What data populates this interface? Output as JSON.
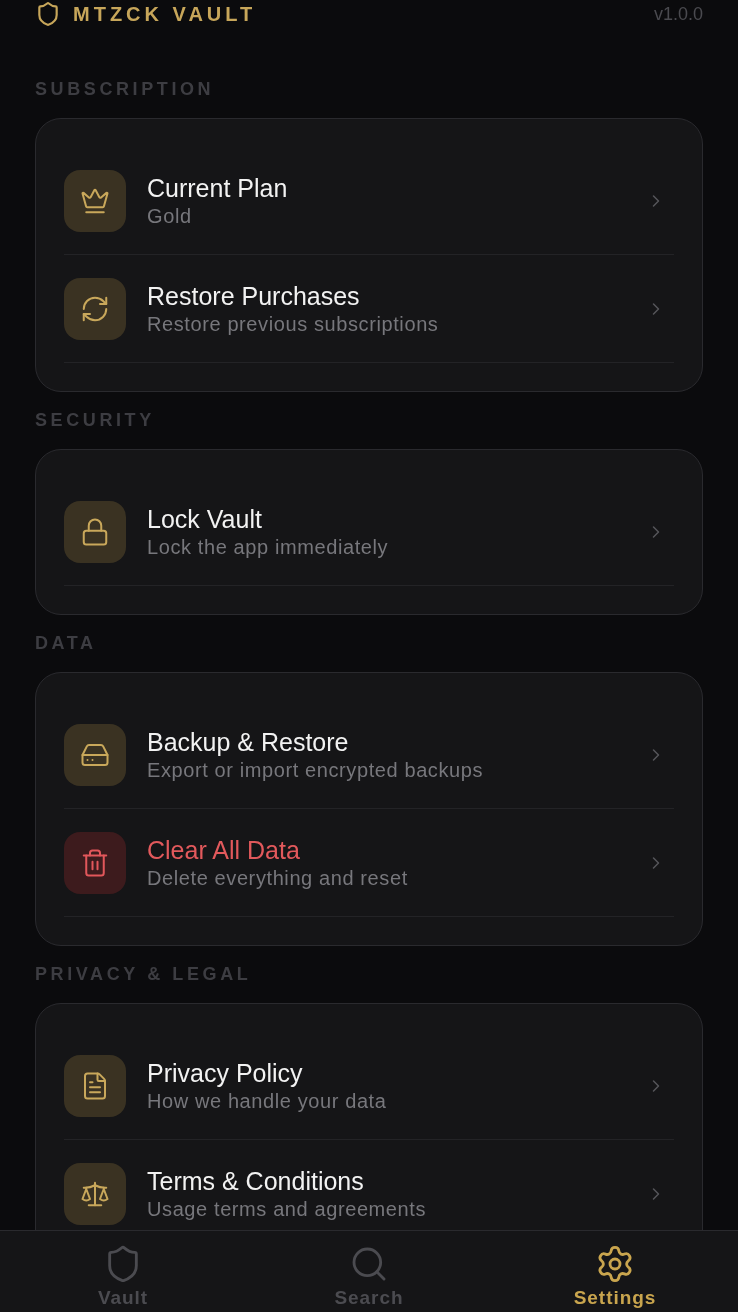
{
  "header": {
    "title": "MTZCK VAULT",
    "version": "v1.0.0"
  },
  "sections": [
    {
      "title": "SUBSCRIPTION",
      "items": [
        {
          "kind": "default",
          "title": "Current Plan",
          "subtitle": "Gold"
        },
        {
          "kind": "default",
          "title": "Restore Purchases",
          "subtitle": "Restore previous subscriptions"
        }
      ]
    },
    {
      "title": "SECURITY",
      "items": [
        {
          "kind": "default",
          "title": "Lock Vault",
          "subtitle": "Lock the app immediately"
        }
      ]
    },
    {
      "title": "DATA",
      "items": [
        {
          "kind": "default",
          "title": "Backup & Restore",
          "subtitle": "Export or import encrypted backups"
        },
        {
          "kind": "danger",
          "title": "Clear All Data",
          "subtitle": "Delete everything and reset"
        }
      ]
    },
    {
      "title": "PRIVACY & LEGAL",
      "items": [
        {
          "kind": "default",
          "title": "Privacy Policy",
          "subtitle": "How we handle your data"
        },
        {
          "kind": "default",
          "title": "Terms & Conditions",
          "subtitle": "Usage terms and agreements"
        }
      ]
    }
  ],
  "tab_bar": [
    {
      "label": "Vault",
      "selected": false
    },
    {
      "label": "Search",
      "selected": false
    },
    {
      "label": "Settings",
      "selected": true
    }
  ]
}
